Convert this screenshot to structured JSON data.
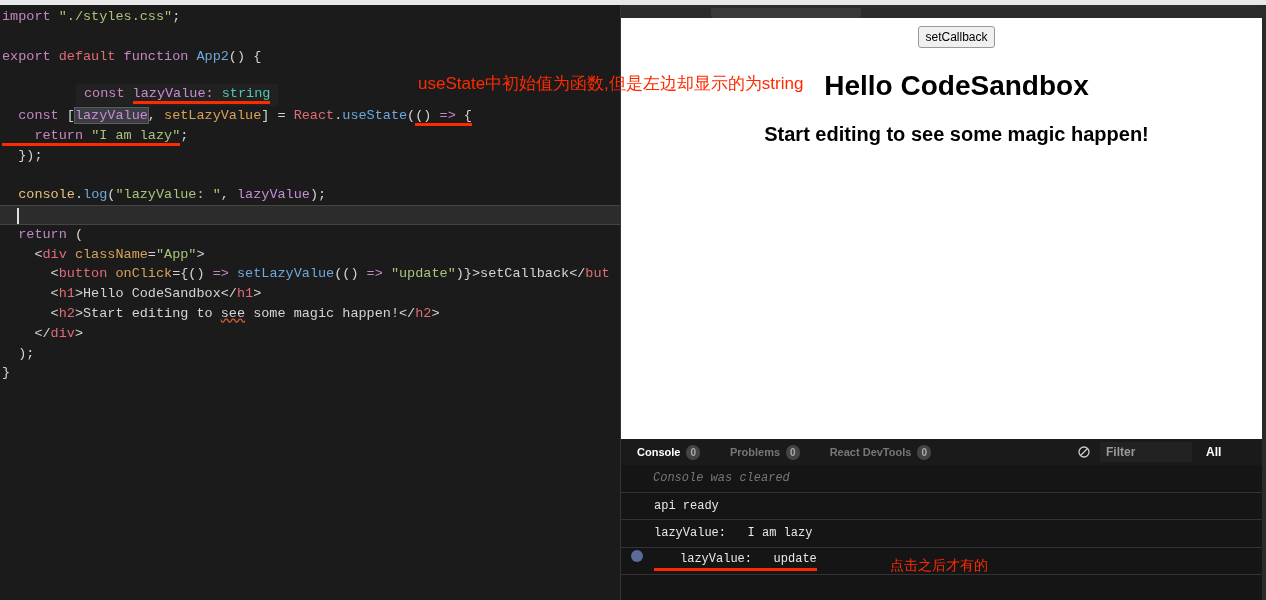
{
  "editor": {
    "lines": [
      {
        "current": false,
        "tokens": [
          {
            "text": "import ",
            "kind": "keyword"
          },
          {
            "text": "\"./styles.css\"",
            "kind": "string"
          },
          {
            "text": ";",
            "kind": "plain"
          }
        ]
      },
      {
        "current": false
      },
      {
        "current": false,
        "tokens": [
          {
            "text": "export ",
            "kind": "keyword"
          },
          {
            "text": "default ",
            "kind": "tag"
          },
          {
            "text": "function ",
            "kind": "keyword"
          },
          {
            "text": "App2",
            "kind": "function"
          },
          {
            "text": "() {",
            "kind": "plain"
          }
        ]
      },
      {
        "current": false
      },
      {
        "current": false
      },
      {
        "current": false,
        "tokens": [
          {
            "text": "  const",
            "kind": "keyword"
          },
          {
            "text": " [",
            "kind": "plain"
          },
          {
            "text": "lazyValue",
            "kind": "variable-highlighted"
          },
          {
            "text": ", ",
            "kind": "plain"
          },
          {
            "text": "setLazyValue",
            "kind": "attr"
          },
          {
            "text": "] = ",
            "kind": "plain"
          },
          {
            "text": "React",
            "kind": "tag"
          },
          {
            "text": ".",
            "kind": "plain"
          },
          {
            "text": "useState",
            "kind": "function"
          },
          {
            "text": "(",
            "kind": "plain"
          },
          {
            "text": "() ",
            "kind": "plain-underlined"
          },
          {
            "text": "=>",
            "kind": "keyword-underlined"
          },
          {
            "text": " {",
            "kind": "plain-underlined"
          }
        ]
      },
      {
        "current": false,
        "tokens": [
          {
            "text": "    return ",
            "kind": "keyword-underlined"
          },
          {
            "text": "\"I am lazy\"",
            "kind": "string-underlined"
          },
          {
            "text": ";",
            "kind": "plain"
          }
        ]
      },
      {
        "current": false,
        "tokens": [
          {
            "text": "  });",
            "kind": "plain"
          }
        ]
      },
      {
        "current": false
      },
      {
        "current": false,
        "tokens": [
          {
            "text": "  console",
            "kind": "object"
          },
          {
            "text": ".",
            "kind": "plain"
          },
          {
            "text": "log",
            "kind": "function"
          },
          {
            "text": "(",
            "kind": "plain"
          },
          {
            "text": "\"lazyValue: \"",
            "kind": "string"
          },
          {
            "text": ", ",
            "kind": "plain"
          },
          {
            "text": "lazyValue",
            "kind": "variable"
          },
          {
            "text": ");",
            "kind": "plain"
          }
        ]
      },
      {
        "current": true
      },
      {
        "current": false,
        "tokens": [
          {
            "text": "  return",
            "kind": "keyword"
          },
          {
            "text": " (",
            "kind": "plain"
          }
        ]
      },
      {
        "current": false,
        "tokens": [
          {
            "text": "    <",
            "kind": "plain"
          },
          {
            "text": "div ",
            "kind": "tag"
          },
          {
            "text": "className",
            "kind": "attr"
          },
          {
            "text": "=",
            "kind": "plain"
          },
          {
            "text": "\"App\"",
            "kind": "string"
          },
          {
            "text": ">",
            "kind": "plain"
          }
        ]
      },
      {
        "current": false,
        "tokens": [
          {
            "text": "      <",
            "kind": "plain"
          },
          {
            "text": "button ",
            "kind": "tag"
          },
          {
            "text": "onClick",
            "kind": "attr"
          },
          {
            "text": "={() ",
            "kind": "plain"
          },
          {
            "text": "=> ",
            "kind": "keyword"
          },
          {
            "text": "setLazyValue",
            "kind": "function"
          },
          {
            "text": "(() ",
            "kind": "plain"
          },
          {
            "text": "=> ",
            "kind": "keyword"
          },
          {
            "text": "\"update\"",
            "kind": "string"
          },
          {
            "text": ")}>setCallback</",
            "kind": "plain"
          },
          {
            "text": "but",
            "kind": "tag"
          }
        ]
      },
      {
        "current": false,
        "tokens": [
          {
            "text": "      <",
            "kind": "plain"
          },
          {
            "text": "h1",
            "kind": "tag"
          },
          {
            "text": ">Hello CodeSandbox</",
            "kind": "plain"
          },
          {
            "text": "h1",
            "kind": "tag"
          },
          {
            "text": ">",
            "kind": "plain"
          }
        ]
      },
      {
        "current": false,
        "tokens": [
          {
            "text": "      <",
            "kind": "plain"
          },
          {
            "text": "h2",
            "kind": "tag"
          },
          {
            "text": ">Start editing to ",
            "kind": "plain"
          },
          {
            "text": "see",
            "kind": "plain-squiggled"
          },
          {
            "text": " some magic happen!</",
            "kind": "plain"
          },
          {
            "text": "h2",
            "kind": "tag"
          },
          {
            "text": ">",
            "kind": "plain"
          }
        ]
      },
      {
        "current": false,
        "tokens": [
          {
            "text": "    </",
            "kind": "plain"
          },
          {
            "text": "div",
            "kind": "tag"
          },
          {
            "text": ">",
            "kind": "plain"
          }
        ]
      },
      {
        "current": false,
        "tokens": [
          {
            "text": "  );",
            "kind": "plain"
          }
        ]
      },
      {
        "current": false,
        "tokens": [
          {
            "text": "}",
            "kind": "plain"
          }
        ]
      }
    ],
    "tooltip": [
      {
        "text": "const ",
        "kind": "keyword"
      },
      {
        "text": "lazyValue: ",
        "kind": "variable-underlined"
      },
      {
        "text": "string",
        "kind": "type-underlined"
      }
    ]
  },
  "annotation_top": "useState中初始值为函数,但是左边却显示的为string",
  "preview": {
    "button": "setCallback",
    "h1": "Hello CodeSandbox",
    "h2": "Start editing to see some magic happen!"
  },
  "console": {
    "tabs": [
      {
        "label": "Console",
        "count": "0",
        "selected": true
      },
      {
        "label": "Problems",
        "count": "0",
        "selected": false
      },
      {
        "label": "React DevTools",
        "count": "0",
        "selected": false
      }
    ],
    "filter": {
      "placeholder": "Filter"
    },
    "level": "All",
    "logs": [
      {
        "kind": "info",
        "parts": [
          "Console was cleared"
        ],
        "underlined": false
      },
      {
        "kind": "log",
        "parts": [
          "api ready"
        ],
        "underlined": false
      },
      {
        "kind": "log",
        "parts": [
          "lazyValue:",
          "I am lazy"
        ],
        "underlined": false
      },
      {
        "kind": "log",
        "parts": [
          "lazyValue:",
          "update"
        ],
        "underlined": true
      }
    ],
    "annotation": "点击之后才有的"
  }
}
